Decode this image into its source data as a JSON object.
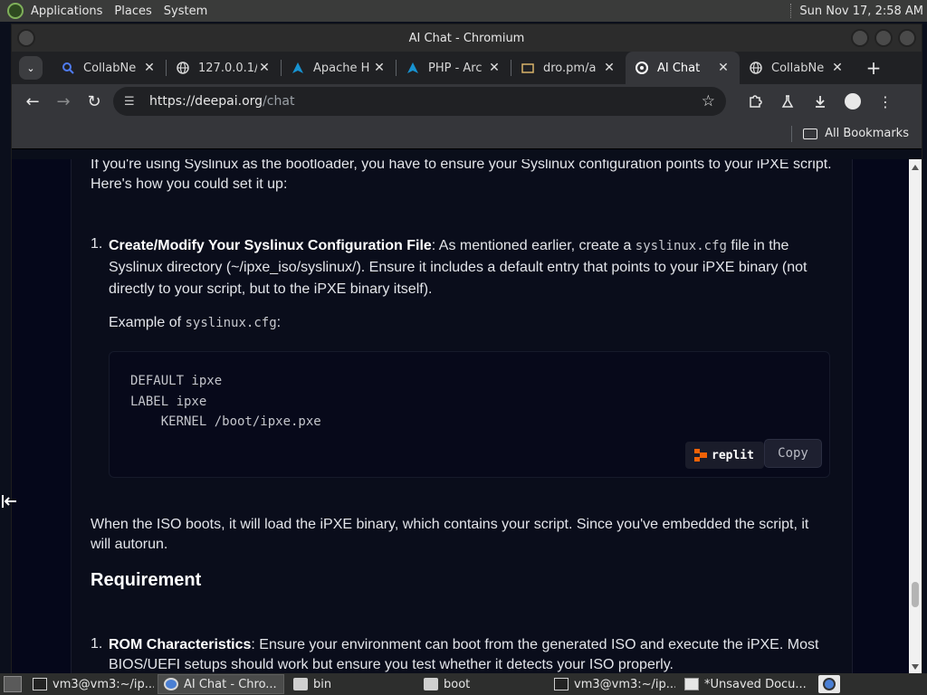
{
  "top_panel": {
    "menus": [
      "Applications",
      "Places",
      "System"
    ],
    "clock": "Sun Nov 17,  2:58 AM"
  },
  "window": {
    "title": "AI Chat - Chromium"
  },
  "tabs": [
    {
      "title": "CollabNe",
      "icon": "search-favicon"
    },
    {
      "title": "127.0.0.1/",
      "icon": "globe-favicon"
    },
    {
      "title": "Apache H",
      "icon": "arch-favicon"
    },
    {
      "title": "PHP - Arc",
      "icon": "arch-favicon"
    },
    {
      "title": "dro.pm/a",
      "icon": "folder-favicon"
    },
    {
      "title": "AI Chat",
      "icon": "deepai-favicon",
      "active": true
    },
    {
      "title": "CollabNe",
      "icon": "globe-favicon"
    }
  ],
  "toolbar": {
    "url_host": "https://deepai.org",
    "url_path": "/chat"
  },
  "bookmarks": {
    "all_label": "All Bookmarks"
  },
  "content": {
    "intro": "If you're using Syslinux as the bootloader, you have to ensure your Syslinux configuration points to your iPXE script. Here's how you could set it up:",
    "item1_num": "1.",
    "item1_bold": "Create/Modify Your Syslinux Configuration File",
    "item1_a": ": As mentioned earlier, create a ",
    "item1_code": "syslinux.cfg",
    "item1_b": " file in the Syslinux directory (~/ipxe_iso/syslinux/). Ensure it includes a default entry that points to your iPXE binary (not directly to your script, but to the iPXE binary itself).",
    "example_prefix": "Example of ",
    "example_code": "syslinux.cfg",
    "example_suffix": ":",
    "code": "DEFAULT ipxe\nLABEL ipxe\n    KERNEL /boot/ipxe.pxe",
    "replit_label": "replit",
    "copy_label": "Copy",
    "paragraph2": "When the ISO boots, it will load the iPXE binary, which contains your script. Since you've embedded the script, it will autorun.",
    "heading": "Requirement",
    "item2_num": "1.",
    "item2_bold": "ROM Characteristics",
    "item2_rest": ": Ensure your environment can boot from the generated ISO and execute the iPXE. Most BIOS/UEFI setups should work but ensure you test whether it detects your ISO properly."
  },
  "taskbar": {
    "items": [
      {
        "label": "vm3@vm3:~/ip...",
        "icon": "terminal-icon"
      },
      {
        "label": "AI Chat - Chro...",
        "icon": "chromium-icon",
        "active": true
      },
      {
        "label": "bin",
        "icon": "folder-icon"
      },
      {
        "label": "boot",
        "icon": "folder-icon"
      },
      {
        "label": "vm3@vm3:~/ip...",
        "icon": "terminal-icon"
      },
      {
        "label": "*Unsaved Docu...",
        "icon": "text-editor-icon"
      }
    ]
  }
}
